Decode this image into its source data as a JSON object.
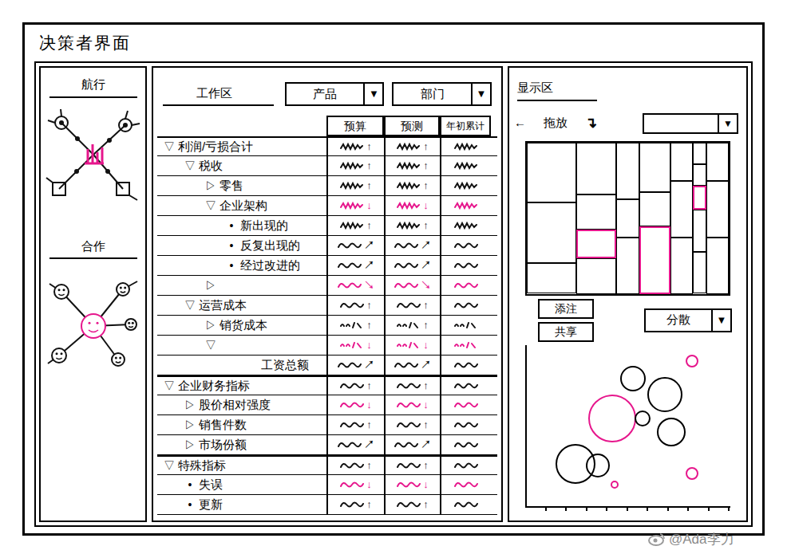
{
  "window": {
    "title": "决策者界面"
  },
  "navigation": {
    "title": "航行"
  },
  "collaboration": {
    "title": "合作"
  },
  "workspace": {
    "title": "工作区",
    "filters": [
      {
        "label": "产品",
        "arrow": "▼"
      },
      {
        "label": "部门",
        "arrow": "▼"
      }
    ],
    "table": {
      "columns": [
        "预算",
        "预测",
        "年初累计"
      ],
      "rows": [
        {
          "marker": "▽",
          "label": "利润/亏损合计",
          "depth": 0,
          "arrows": [
            "↑",
            "↑"
          ],
          "kind": "zigzag",
          "flagged": false
        },
        {
          "marker": "▽",
          "label": "税收",
          "depth": 1,
          "arrows": [
            "↑",
            "↑"
          ],
          "kind": "zigzag",
          "flagged": false
        },
        {
          "marker": "▷",
          "label": "零售",
          "depth": 2,
          "arrows": [
            "↑",
            "↑"
          ],
          "kind": "zigzag",
          "flagged": false
        },
        {
          "marker": "▽",
          "label": "企业架构",
          "depth": 2,
          "arrows": [
            "↓",
            "↓"
          ],
          "kind": "zigzag",
          "flagged": true
        },
        {
          "marker": "•",
          "label": "新出现的",
          "depth": 3,
          "arrows": [
            "↑",
            "↑"
          ],
          "kind": "zigzag",
          "flagged": false
        },
        {
          "marker": "•",
          "label": "反复出现的",
          "depth": 3,
          "arrows": [
            "↗",
            "↗"
          ],
          "kind": "wave",
          "flagged": false
        },
        {
          "marker": "•",
          "label": "经过改进的",
          "depth": 3,
          "arrows": [
            "↗",
            "↗"
          ],
          "kind": "wave",
          "flagged": false
        },
        {
          "marker": "▷",
          "label": "",
          "depth": 2,
          "arrows": [
            "↘",
            "↘"
          ],
          "kind": "wave",
          "flagged": true
        },
        {
          "marker": "▽",
          "label": "运营成本",
          "depth": 1,
          "arrows": [
            "↑",
            "↑"
          ],
          "kind": "wave",
          "flagged": false
        },
        {
          "marker": "▷",
          "label": "销货成本",
          "depth": 2,
          "arrows": [
            "↑",
            "↑"
          ],
          "kind": "dashes",
          "flagged": false
        },
        {
          "marker": "▽",
          "label": "",
          "depth": 2,
          "arrows": [
            "↓",
            "↓"
          ],
          "kind": "dashes",
          "flagged": true
        },
        {
          "marker": "",
          "label": "工资总额",
          "depth": 4,
          "arrows": [
            "↗",
            "↗"
          ],
          "kind": "wave",
          "flagged": false
        },
        {
          "marker": "▽",
          "label": "企业财务指标",
          "depth": 0,
          "arrows": [
            "↑",
            "↑"
          ],
          "kind": "wave",
          "flagged": false
        },
        {
          "marker": "▷",
          "label": "股价相对强度",
          "depth": 1,
          "arrows": [
            "↓",
            "↓"
          ],
          "kind": "wave",
          "flagged": true
        },
        {
          "marker": "▷",
          "label": "销售件数",
          "depth": 1,
          "arrows": [
            "↑",
            "↑"
          ],
          "kind": "wave",
          "flagged": false
        },
        {
          "marker": "▷",
          "label": "市场份额",
          "depth": 1,
          "arrows": [
            "↗",
            "↗"
          ],
          "kind": "wave",
          "flagged": false
        },
        {
          "marker": "▽",
          "label": "特殊指标",
          "depth": 0,
          "arrows": [
            "↑",
            "↑"
          ],
          "kind": "wave",
          "flagged": false
        },
        {
          "marker": "•",
          "label": "失误",
          "depth": 1,
          "arrows": [
            "↓",
            "↓"
          ],
          "kind": "wave",
          "flagged": true
        },
        {
          "marker": "•",
          "label": "更新",
          "depth": 1,
          "arrows": [
            "↑",
            "↑"
          ],
          "kind": "wave",
          "flagged": false
        }
      ]
    }
  },
  "display": {
    "title": "显示区",
    "drag": {
      "left_arrow": "←",
      "label": "拖放",
      "down_arrow": "↴",
      "select_arrow": "▼"
    },
    "treemap": {
      "columns": [
        {
          "value": 2.2,
          "tiles": [
            {
              "value": 4,
              "highlight": false
            },
            {
              "value": 4,
              "highlight": false
            },
            {
              "value": 2,
              "highlight": false
            }
          ]
        },
        {
          "value": 1.8,
          "tiles": [
            {
              "value": 3,
              "highlight": false
            },
            {
              "value": 2,
              "highlight": false
            },
            {
              "value": 1.5,
              "highlight": true
            },
            {
              "value": 2,
              "highlight": false
            }
          ]
        },
        {
          "value": 1.0,
          "tiles": [
            {
              "value": 3,
              "highlight": false
            },
            {
              "value": 2,
              "highlight": false
            },
            {
              "value": 3,
              "highlight": false
            }
          ]
        },
        {
          "value": 1.4,
          "tiles": [
            {
              "value": 3,
              "highlight": false
            },
            {
              "value": 2,
              "highlight": false
            },
            {
              "value": 4,
              "highlight": true
            }
          ]
        },
        {
          "value": 1.0,
          "tiles": [
            {
              "value": 2,
              "highlight": false
            },
            {
              "value": 3,
              "highlight": false
            },
            {
              "value": 3,
              "highlight": false
            }
          ]
        },
        {
          "value": 0.6,
          "tiles": [
            {
              "value": 1,
              "highlight": false
            },
            {
              "value": 1,
              "highlight": false
            },
            {
              "value": 1,
              "highlight": true
            },
            {
              "value": 2,
              "highlight": false
            },
            {
              "value": 2,
              "highlight": false
            }
          ]
        },
        {
          "value": 1.0,
          "tiles": [
            {
              "value": 2,
              "highlight": false
            },
            {
              "value": 3,
              "highlight": false
            },
            {
              "value": 3,
              "highlight": false
            }
          ]
        }
      ]
    },
    "buttons": [
      "添注",
      "共享"
    ],
    "chart_select": {
      "label": "分散",
      "arrow": "▼"
    },
    "scatter": {
      "points": [
        {
          "x": 5.2,
          "y": 7.9,
          "size": 16,
          "highlight": false
        },
        {
          "x": 8.1,
          "y": 9.0,
          "size": 8,
          "highlight": true
        },
        {
          "x": 4.2,
          "y": 5.4,
          "size": 30,
          "highlight": true
        },
        {
          "x": 6.8,
          "y": 6.9,
          "size": 22,
          "highlight": false
        },
        {
          "x": 5.7,
          "y": 5.4,
          "size": 10,
          "highlight": false
        },
        {
          "x": 7.1,
          "y": 4.6,
          "size": 18,
          "highlight": false
        },
        {
          "x": 2.4,
          "y": 2.6,
          "size": 25,
          "highlight": false
        },
        {
          "x": 3.5,
          "y": 2.5,
          "size": 15,
          "highlight": false
        },
        {
          "x": 8.1,
          "y": 2.0,
          "size": 8,
          "highlight": true
        },
        {
          "x": 4.3,
          "y": 1.3,
          "size": 5,
          "highlight": true
        }
      ]
    }
  },
  "watermark": "@Ada李力"
}
